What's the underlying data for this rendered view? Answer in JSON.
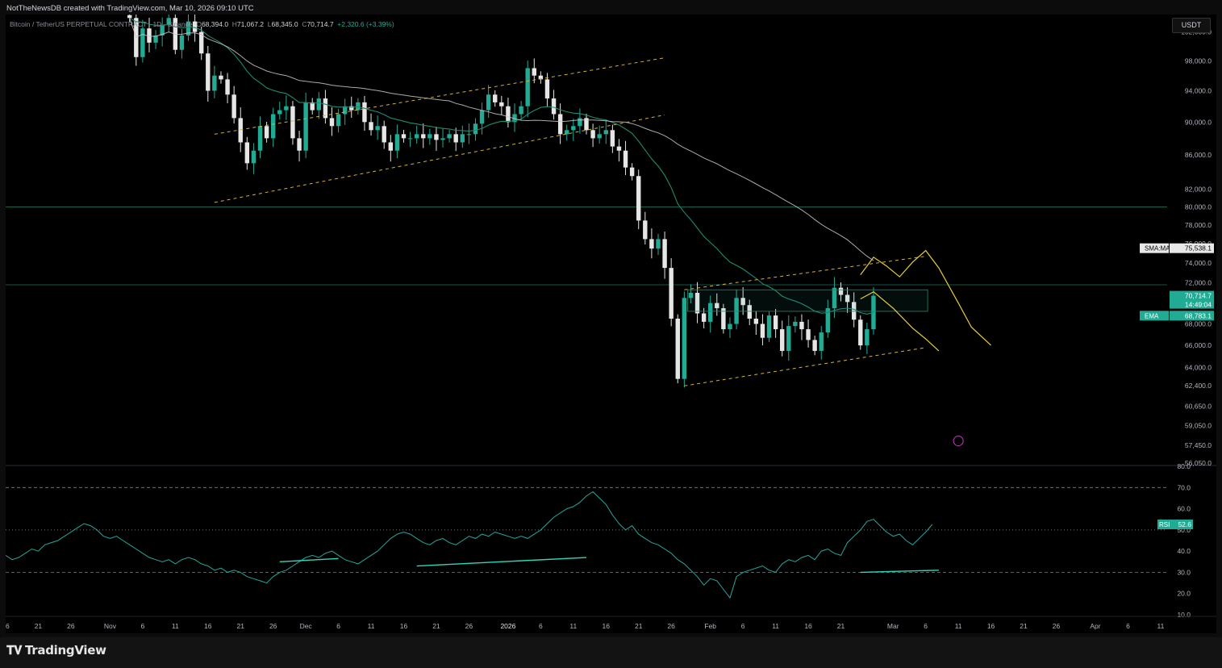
{
  "header": {
    "credit": "NotTheNewsDB created with TradingView.com, Mar 10, 2026 09:10 UTC"
  },
  "legend": {
    "symbol": "Bitcoin / TetherUS PERPETUAL CONTRACT · 1D · Binance",
    "open_label": "O",
    "open": "68,394.0",
    "high_label": "H",
    "high": "71,067.2",
    "low_label": "L",
    "low": "68,345.0",
    "close_label": "C",
    "close": "70,714.7",
    "change": "+2,320.6 (+3.39%)"
  },
  "currency": "USDT",
  "footer": {
    "logo_text": "TradingView"
  },
  "colors": {
    "up": "#22ab94",
    "down": "#e6e6e6",
    "ema": "#1f8a70",
    "sma": "#c9c9c9",
    "channel": "#d4b13a",
    "rsi": "#26a69a",
    "projection": "#e4cd3a"
  },
  "chart_data": [
    {
      "type": "candlestick",
      "title": "Bitcoin / TetherUS PERPETUAL CONTRACT · 1D · Binance",
      "y_scale": "log",
      "ylim": [
        56050,
        104500
      ],
      "y_ticks": [
        "102,000.0",
        "98,000.0",
        "94,000.0",
        "90,000.0",
        "86,000.0",
        "82,000.0",
        "80,000.0",
        "78,000.0",
        "76,000.0",
        "74,000.0",
        "72,000.0",
        "68,000.0",
        "66,000.0",
        "64,000.0",
        "62,400.0",
        "60,650.0",
        "59,050.0",
        "57,450.0",
        "56,050.0"
      ],
      "x_ticks": [
        {
          "label": "16",
          "day": 0
        },
        {
          "label": "21",
          "day": 5
        },
        {
          "label": "26",
          "day": 10
        },
        {
          "label": "Nov",
          "day": 16
        },
        {
          "label": "6",
          "day": 21
        },
        {
          "label": "11",
          "day": 26
        },
        {
          "label": "16",
          "day": 31
        },
        {
          "label": "21",
          "day": 36
        },
        {
          "label": "26",
          "day": 41
        },
        {
          "label": "Dec",
          "day": 46
        },
        {
          "label": "6",
          "day": 51
        },
        {
          "label": "11",
          "day": 56
        },
        {
          "label": "16",
          "day": 61
        },
        {
          "label": "21",
          "day": 66
        },
        {
          "label": "26",
          "day": 71
        },
        {
          "label": "2026",
          "day": 77
        },
        {
          "label": "6",
          "day": 82
        },
        {
          "label": "11",
          "day": 87
        },
        {
          "label": "16",
          "day": 92
        },
        {
          "label": "21",
          "day": 97
        },
        {
          "label": "26",
          "day": 102
        },
        {
          "label": "Feb",
          "day": 108
        },
        {
          "label": "6",
          "day": 113
        },
        {
          "label": "11",
          "day": 118
        },
        {
          "label": "16",
          "day": 123
        },
        {
          "label": "21",
          "day": 128
        },
        {
          "label": "Mar",
          "day": 136
        },
        {
          "label": "6",
          "day": 141
        },
        {
          "label": "11",
          "day": 146
        },
        {
          "label": "16",
          "day": 151
        },
        {
          "label": "21",
          "day": 156
        },
        {
          "label": "26",
          "day": 161
        },
        {
          "label": "Apr",
          "day": 167
        },
        {
          "label": "6",
          "day": 172
        },
        {
          "label": "11",
          "day": 177
        }
      ],
      "x_domain": [
        0,
        178
      ],
      "start_day": 19,
      "closes": [
        104000,
        98500,
        102500,
        100500,
        101500,
        103000,
        104000,
        99500,
        101500,
        103500,
        102000,
        99000,
        94000,
        96000,
        95500,
        93500,
        90500,
        87500,
        85000,
        86500,
        89500,
        88000,
        91000,
        91500,
        92000,
        88000,
        86500,
        92500,
        91500,
        93000,
        90500,
        89500,
        91000,
        92000,
        91500,
        92500,
        90000,
        89000,
        89500,
        87500,
        86500,
        88500,
        88000,
        88000,
        88500,
        88000,
        88500,
        87800,
        88000,
        88500,
        87500,
        88500,
        88500,
        89800,
        91500,
        93500,
        92500,
        92000,
        90000,
        91000,
        92000,
        97000,
        96000,
        95500,
        93000,
        91000,
        88500,
        89000,
        89500,
        90500,
        89000,
        88000,
        88500,
        89000,
        87000,
        86500,
        84500,
        83500,
        78500,
        76500,
        75500,
        76500,
        73500,
        68500,
        63000,
        70500,
        71000,
        69000,
        68200,
        70000,
        69500,
        67500,
        68000,
        70500,
        69800,
        68500,
        68000,
        66700,
        68800,
        67500,
        65500,
        67800,
        68200,
        67500,
        66500,
        65500,
        67200,
        69500,
        71500,
        70800,
        70100,
        68400,
        66000,
        67500,
        70714.7
      ],
      "ema": {
        "name": "EMA",
        "value": "68,783.1"
      },
      "sma": {
        "name": "SMA:MA",
        "value": "75,538.1"
      },
      "last_price": {
        "value": "70,714.7",
        "countdown": "14:49:04"
      },
      "horizontal_levels": [
        80000,
        71800
      ],
      "channels": [
        {
          "from": [
            32,
            80500
          ],
          "to": [
            101,
            90900
          ]
        },
        {
          "from": [
            32,
            88500
          ],
          "to": [
            101,
            98400
          ]
        },
        {
          "from": [
            104,
            62400
          ],
          "to": [
            141,
            65800
          ]
        },
        {
          "from": [
            104,
            71300
          ],
          "to": [
            141,
            74700
          ]
        }
      ],
      "projection_path": [
        [
          131,
          72800
        ],
        [
          133,
          74600
        ],
        [
          135,
          73700
        ],
        [
          137,
          72600
        ],
        [
          139,
          74100
        ],
        [
          141,
          75300
        ],
        [
          143,
          73500
        ],
        [
          146,
          70000
        ],
        [
          148,
          67700
        ],
        [
          151,
          66000
        ]
      ],
      "projection_path_short": [
        [
          131,
          70400
        ],
        [
          133,
          71100
        ],
        [
          136,
          69500
        ],
        [
          139,
          67600
        ],
        [
          141,
          66600
        ],
        [
          143,
          65500
        ]
      ]
    },
    {
      "type": "line",
      "title": "RSI",
      "series": [
        {
          "name": "RSI",
          "last": "52.6",
          "values": [
            38,
            36,
            37,
            39,
            41,
            40,
            43,
            44,
            45,
            47,
            49,
            51,
            53,
            52,
            50,
            47,
            46,
            47,
            45,
            43,
            41,
            39,
            37,
            36,
            35,
            36,
            34,
            36,
            37,
            36,
            34,
            33,
            31,
            32,
            30,
            31,
            30,
            28,
            27,
            26,
            25,
            28,
            30,
            31,
            33,
            35,
            37,
            38,
            37,
            39,
            40,
            38,
            36,
            35,
            34,
            36,
            38,
            40,
            43,
            46,
            48,
            49,
            48,
            46,
            44,
            43,
            45,
            46,
            44,
            43,
            45,
            47,
            46,
            48,
            47,
            49,
            48,
            47,
            46,
            47,
            46,
            48,
            50,
            53,
            56,
            58,
            60,
            61,
            63,
            66,
            68,
            65,
            62,
            57,
            53,
            50,
            52,
            48,
            46,
            44,
            43,
            41,
            39,
            36,
            34,
            31,
            28,
            24,
            27,
            26,
            22,
            18,
            28,
            30,
            31,
            32,
            33,
            31,
            30,
            34,
            36,
            35,
            37,
            38,
            36,
            40,
            41,
            39,
            38,
            44,
            47,
            50,
            54,
            55,
            52,
            49,
            47,
            48,
            45,
            43,
            46,
            49,
            52.6
          ]
        }
      ],
      "ylim": [
        10,
        80
      ],
      "y_ticks": [
        "80.0",
        "70.0",
        "60.0",
        "50.0",
        "40.0",
        "30.0",
        "20.0",
        "10.0"
      ],
      "bands": [
        70,
        50,
        30
      ],
      "divergences": [
        {
          "from": [
            42,
            35
          ],
          "to": [
            51,
            36.5
          ]
        },
        {
          "from": [
            63,
            33
          ],
          "to": [
            89,
            37
          ]
        },
        {
          "from": [
            131,
            30
          ],
          "to": [
            143,
            31
          ]
        }
      ]
    }
  ]
}
